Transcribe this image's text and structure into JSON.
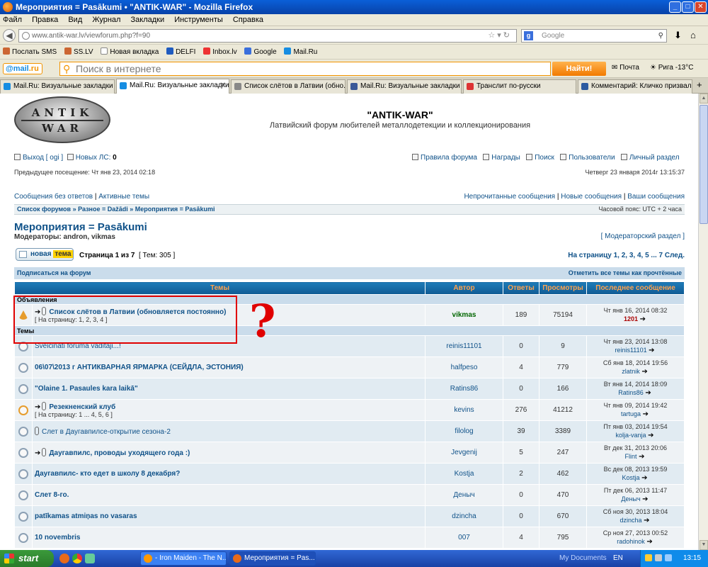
{
  "window": {
    "title": "Мероприятия = Pasākumi • \"ANTIK-WAR\" - Mozilla Firefox"
  },
  "menu": [
    "Файл",
    "Правка",
    "Вид",
    "Журнал",
    "Закладки",
    "Инструменты",
    "Справка"
  ],
  "nav": {
    "url": "www.antik-war.lv/viewforum.php?f=90",
    "search_placeholder": "Google"
  },
  "bookmarks": [
    "Послать SMS",
    "SS.LV",
    "Новая вкладка",
    "DELFI",
    "Inbox.lv",
    "Google",
    "Mail.Ru"
  ],
  "mailbar": {
    "logo_a": "@mail",
    "logo_b": ".ru",
    "search_placeholder": "Поиск в интернете",
    "find_button": "Найти!",
    "mail": "Почта",
    "weather": "Рига -13°C"
  },
  "tabs": [
    {
      "label": "Mail.Ru: Визуальные закладки"
    },
    {
      "label": "Mail.Ru: Визуальные закладки"
    },
    {
      "label": "Список слётов в Латвии (обно..."
    },
    {
      "label": "Mail.Ru: Визуальные закладки"
    },
    {
      "label": "Транслит по-русски"
    },
    {
      "label": "Комментарий: Кличко призвал..."
    }
  ],
  "header": {
    "logo_top": "ANTIK",
    "logo_bottom": "WAR",
    "site_title": "\"ANTIK-WAR\"",
    "site_desc": "Латвийский форум любителей металлодетекции и коллекционирования"
  },
  "userbar": {
    "logout": "Выход [ ogi ]",
    "new_pm_label": "Новых ЛС:",
    "new_pm_count": "0",
    "rules": "Правила форума",
    "awards": "Награды",
    "search": "Поиск",
    "users": "Пользователи",
    "personal": "Личный раздел",
    "last_visit": "Предыдущее посещение: Чт янв 23, 2014 02:18",
    "current_time": "Четверг 23 января 2014г 13:15:37"
  },
  "quicklinks": {
    "unanswered": "Сообщения без ответов",
    "active": "Активные темы",
    "unread": "Непрочитанные сообщения",
    "new": "Новые сообщения",
    "yours": "Ваши сообщения"
  },
  "breadcrumb": {
    "path": "Список форумов » Разное = Dažādi » Мероприятия = Pasākumi",
    "timezone": "Часовой пояс: UTC + 2 часа"
  },
  "forum": {
    "title": "Мероприятия = Pasākumi",
    "mods_label": "Модераторы:",
    "mods": "andron, vikmas",
    "mod_section": "[ Модераторский раздел ]",
    "new_topic_a": "новая",
    "new_topic_b": "тема",
    "page_info": "Страница 1 из 7",
    "topics_count": "[ Тем: 305 ]",
    "pagination": "На страницу 1, 2, 3, 4, 5 ... 7  След.",
    "subscribe": "Подписаться на форум",
    "mark_read": "Отметить все темы как прочтённые"
  },
  "table": {
    "headers": [
      "Темы",
      "Автор",
      "Ответы",
      "Просмотры",
      "Последнее сообщение"
    ],
    "section_ann": "Объявления",
    "section_topics": "Темы",
    "announcement": {
      "title": "Список слётов в Латвии (обновляется постоянно)",
      "pages": "[ На страницу: 1, 2, 3, 4 ]",
      "author": "vikmas",
      "replies": "189",
      "views": "75194",
      "last_date": "Чт янв 16, 2014 08:32",
      "last_user": "1201"
    },
    "topics": [
      {
        "title": "Sveicinati foruma vaditaji...!",
        "pages": "",
        "author": "reinis11101",
        "replies": "0",
        "views": "9",
        "last_date": "Чт янв 23, 2014 13:08",
        "last_user": "reinis11101"
      },
      {
        "title": "06\\07\\2013 г АНТИКВАРНАЯ ЯРМАРКА (СЕЙДЛА, ЭСТОНИЯ)",
        "pages": "",
        "author": "halfpeso",
        "replies": "4",
        "views": "779",
        "last_date": "Сб янв 18, 2014 19:56",
        "last_user": "zlatnik"
      },
      {
        "title": "\"Olaine 1. Pasaules kara laikā\"",
        "pages": "",
        "author": "Ratins86",
        "replies": "0",
        "views": "166",
        "last_date": "Вт янв 14, 2014 18:09",
        "last_user": "Ratins86"
      },
      {
        "title": "Резекненский клуб",
        "pages": "[ На страницу: 1 ... 4, 5, 6 ]",
        "author": "kevins",
        "replies": "276",
        "views": "41212",
        "last_date": "Чт янв 09, 2014 19:42",
        "last_user": "tartuga"
      },
      {
        "title": "Слет в Даугавпилсе-открытие сезона-2",
        "pages": "",
        "author": "filolog",
        "replies": "39",
        "views": "3389",
        "last_date": "Пт янв 03, 2014 19:54",
        "last_user": "kolja-vanja"
      },
      {
        "title": "Даугавпилс, проводы уходящего года :)",
        "pages": "",
        "author": "Jevgenij",
        "replies": "5",
        "views": "247",
        "last_date": "Вт дек 31, 2013 20:06",
        "last_user": "Flint"
      },
      {
        "title": "Даугавпилс- кто едет в школу 8 декабря?",
        "pages": "",
        "author": "Kostja",
        "replies": "2",
        "views": "462",
        "last_date": "Вс дек 08, 2013 19:59",
        "last_user": "Kostja"
      },
      {
        "title": "Слет 8-го.",
        "pages": "",
        "author": "Деныч",
        "replies": "0",
        "views": "470",
        "last_date": "Пт дек 06, 2013 11:47",
        "last_user": "Деныч"
      },
      {
        "title": "patīkamas atmiņas no vasaras",
        "pages": "",
        "author": "dzincha",
        "replies": "0",
        "views": "670",
        "last_date": "Сб ноя 30, 2013 18:04",
        "last_user": "dzincha"
      },
      {
        "title": "10 novembris",
        "pages": "",
        "author": "007",
        "replies": "4",
        "views": "795",
        "last_date": "Ср ноя 27, 2013 00:52",
        "last_user": "radohinok"
      }
    ]
  },
  "annotation": {
    "question": "?"
  },
  "taskbar": {
    "start": "start",
    "items": [
      "- Iron Maiden - The N...",
      "Мероприятия = Pas..."
    ],
    "my_documents": "My Documents",
    "lang": "EN",
    "time": "13:15"
  }
}
